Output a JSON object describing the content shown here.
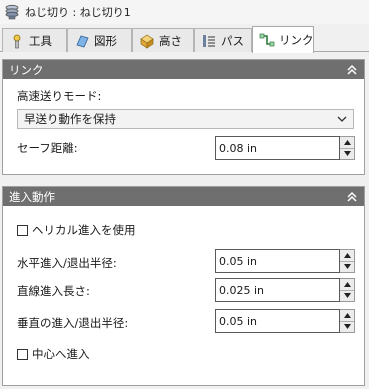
{
  "title": "ねじ切り : ねじ切り1",
  "tabs": [
    {
      "label": "工具",
      "icon": "tool-icon"
    },
    {
      "label": "図形",
      "icon": "geometry-icon"
    },
    {
      "label": "高さ",
      "icon": "heights-icon"
    },
    {
      "label": "パス",
      "icon": "passes-icon"
    },
    {
      "label": "リンク",
      "icon": "linking-icon",
      "active": true
    }
  ],
  "link_panel": {
    "title": "リンク",
    "rapid_mode_label": "高速送りモード:",
    "rapid_mode_value": "早送り動作を保持",
    "safe_distance_label": "セーフ距離:",
    "safe_distance_value": "0.08 in"
  },
  "entry_panel": {
    "title": "進入動作",
    "helical_label": "ヘリカル進入を使用",
    "helical_checked": false,
    "horiz_radius_label": "水平進入/退出半径:",
    "horiz_radius_value": "0.05 in",
    "linear_length_label": "直線進入長さ:",
    "linear_length_value": "0.025 in",
    "vert_radius_label": "垂直の進入/退出半径:",
    "vert_radius_value": "0.05 in",
    "center_label": "中心へ進入",
    "center_checked": false
  },
  "colors": {
    "panel_header": "#6f6f6f",
    "window_bg": "#f0f0f0",
    "active_tab": "#ffffff"
  }
}
